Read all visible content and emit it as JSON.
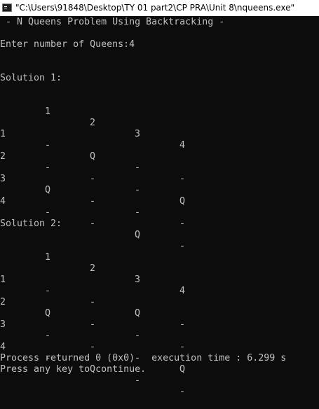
{
  "window": {
    "title": "\"C:\\Users\\91848\\Desktop\\TY 01 part2\\CP PRA\\Unit 8\\nqueens.exe\""
  },
  "console": {
    "header": " - N Queens Problem Using Backtracking -",
    "prompt": "Enter number of Queens:4",
    "solutions": [
      {
        "title": "Solution 1:",
        "columns": [
          "1",
          "2",
          "3",
          "4"
        ],
        "rows": [
          {
            "label": "1",
            "cells": [
              "-",
              "Q",
              "-",
              "-"
            ]
          },
          {
            "label": "2",
            "cells": [
              "-",
              "-",
              "-",
              "Q"
            ]
          },
          {
            "label": "3",
            "cells": [
              "Q",
              "-",
              "-",
              "-"
            ]
          },
          {
            "label": "4",
            "cells": [
              "-",
              "-",
              "Q",
              "-"
            ]
          }
        ]
      },
      {
        "title": "Solution 2:",
        "columns": [
          "1",
          "2",
          "3",
          "4"
        ],
        "rows": [
          {
            "label": "1",
            "cells": [
              "-",
              "-",
              "Q",
              "-"
            ]
          },
          {
            "label": "2",
            "cells": [
              "Q",
              "-",
              "-",
              "-"
            ]
          },
          {
            "label": "3",
            "cells": [
              "-",
              "-",
              "-",
              "Q"
            ]
          },
          {
            "label": "4",
            "cells": [
              "-",
              "Q",
              "-",
              "-"
            ]
          }
        ]
      }
    ],
    "footer": {
      "process_line": "Process returned 0 (0x0)   execution time : 6.299 s",
      "continue_line": "Press any key to continue."
    }
  }
}
